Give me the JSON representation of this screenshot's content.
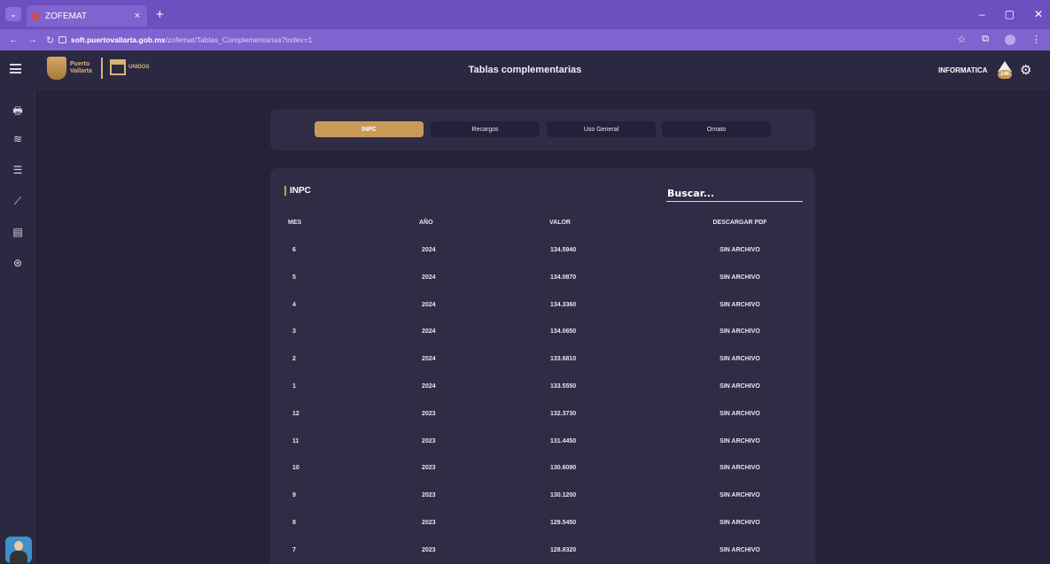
{
  "browser": {
    "tab_title": "ZOFEMAT",
    "tab_close": "×",
    "new_tab": "+",
    "url_host": "soft.puertovallarta.gob.mx",
    "url_path": "/zofemat/Tablas_Complementarias?index=1",
    "window_controls": [
      "–",
      "▢",
      "✕"
    ]
  },
  "header": {
    "logo_text_1": "Puerto",
    "logo_text_2": "Vallarta",
    "logo_unidos": "UNIDOS",
    "title": "Tablas complementarias",
    "user_name": "INFORMATICA",
    "user_badge": "246"
  },
  "tabs": [
    {
      "label": "INPC",
      "active": true
    },
    {
      "label": "Recargos",
      "active": false
    },
    {
      "label": "Uso General",
      "active": false
    },
    {
      "label": "Ornato",
      "active": false
    }
  ],
  "table": {
    "title": "INPC",
    "search_placeholder": "Buscar...",
    "columns": [
      "MES",
      "AÑO",
      "VALOR",
      "DESCARGAR PDF"
    ],
    "rows": [
      {
        "mes": "6",
        "anio": "2024",
        "valor": "134.5940",
        "pdf": "SIN ARCHIVO"
      },
      {
        "mes": "5",
        "anio": "2024",
        "valor": "134.0870",
        "pdf": "SIN ARCHIVO"
      },
      {
        "mes": "4",
        "anio": "2024",
        "valor": "134.3360",
        "pdf": "SIN ARCHIVO"
      },
      {
        "mes": "3",
        "anio": "2024",
        "valor": "134.0650",
        "pdf": "SIN ARCHIVO"
      },
      {
        "mes": "2",
        "anio": "2024",
        "valor": "133.6810",
        "pdf": "SIN ARCHIVO"
      },
      {
        "mes": "1",
        "anio": "2024",
        "valor": "133.5550",
        "pdf": "SIN ARCHIVO"
      },
      {
        "mes": "12",
        "anio": "2023",
        "valor": "132.3730",
        "pdf": "SIN ARCHIVO"
      },
      {
        "mes": "11",
        "anio": "2023",
        "valor": "131.4450",
        "pdf": "SIN ARCHIVO"
      },
      {
        "mes": "10",
        "anio": "2023",
        "valor": "130.6090",
        "pdf": "SIN ARCHIVO"
      },
      {
        "mes": "9",
        "anio": "2023",
        "valor": "130.1200",
        "pdf": "SIN ARCHIVO"
      },
      {
        "mes": "8",
        "anio": "2023",
        "valor": "129.5450",
        "pdf": "SIN ARCHIVO"
      },
      {
        "mes": "7",
        "anio": "2023",
        "valor": "128.8320",
        "pdf": "SIN ARCHIVO"
      }
    ]
  },
  "sidebar": {
    "icons": [
      "printer-icon",
      "waves-icon",
      "list-icon",
      "chart-line-icon",
      "id-card-icon",
      "fingerprint-icon"
    ]
  },
  "colors": {
    "browser_chrome": "#6d4fc0",
    "background": "#25233a",
    "card": "#2f2d46",
    "accent": "#c89a5a"
  }
}
